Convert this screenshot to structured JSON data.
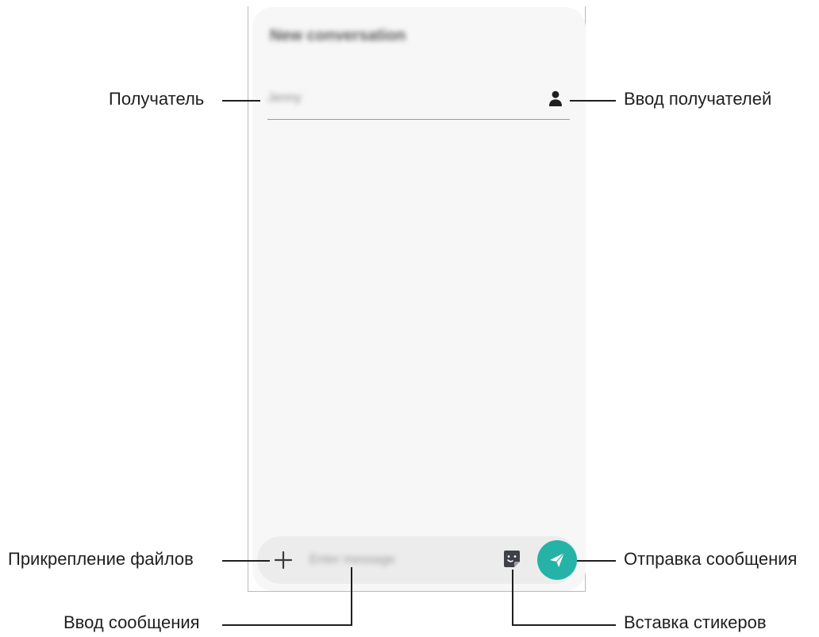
{
  "screen": {
    "title": "New conversation",
    "recipient_placeholder": "Jenny",
    "message_placeholder": "Enter message"
  },
  "icons": {
    "contacts": "contact-person-icon",
    "attach": "plus-icon",
    "sticker": "sticker-icon",
    "send": "send-icon"
  },
  "colors": {
    "send_button": "#26b3a7",
    "screen_bg": "#f7f7f7",
    "compose_bar": "#ececec"
  },
  "callouts": {
    "recipient": "Получатель",
    "enter_recipients": "Ввод получателей",
    "attach_files": "Прикрепление файлов",
    "send_message": "Отправка сообщения",
    "enter_message": "Ввод сообщения",
    "insert_stickers": "Вставка стикеров"
  }
}
